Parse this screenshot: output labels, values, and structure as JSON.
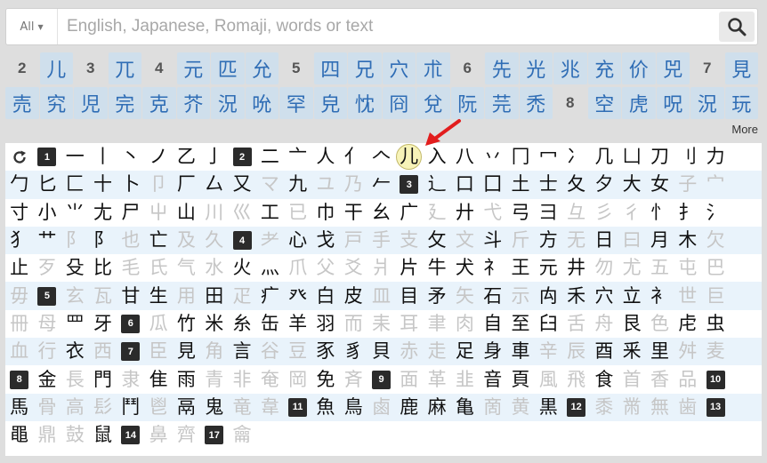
{
  "search": {
    "scope": "All",
    "placeholder": "English, Japanese, Romaji, words or text",
    "icon": "search-icon"
  },
  "results": {
    "rows": [
      [
        "2",
        "儿",
        "3",
        "兀",
        "4",
        "元",
        "匹",
        "允",
        "5",
        "四",
        "兄",
        "穴",
        "朮",
        "6",
        "先",
        "光",
        "兆",
        "充",
        "价",
        "兕",
        "7",
        "見"
      ],
      [
        "売",
        "究",
        "児",
        "完",
        "克",
        "芥",
        "況",
        "吮",
        "罕",
        "皃",
        "忱",
        "冏",
        "兌",
        "阮",
        "芫",
        "禿",
        "8",
        "空",
        "虎",
        "呪",
        "況",
        "玩"
      ]
    ],
    "more_label": "More"
  },
  "panel": {
    "selected": "儿",
    "rows": [
      [
        "@r",
        "#1",
        "一",
        "丨",
        "丶",
        "ノ",
        "乙",
        "亅",
        "#2",
        "二",
        "亠",
        "人",
        "亻",
        "𠆢",
        "*儿",
        "入",
        "八",
        "丷",
        "冂",
        "冖",
        "冫",
        "几",
        "凵",
        "刀",
        "刂",
        "力"
      ],
      [
        "勹",
        "匕",
        "匚",
        "十",
        "卜",
        "~卩",
        "厂",
        "厶",
        "又",
        "~マ",
        "九",
        "~ユ",
        "~乃",
        "𠂉",
        "#3",
        "⻌",
        "口",
        "囗",
        "土",
        "士",
        "夂",
        "夕",
        "大",
        "女",
        "~子",
        "~宀"
      ],
      [
        "寸",
        "小",
        "⺌",
        "尢",
        "尸",
        "~屮",
        "山",
        "~川",
        "~巛",
        "工",
        "~已",
        "巾",
        "干",
        "幺",
        "广",
        "~廴",
        "廾",
        "~弋",
        "弓",
        "彐",
        "~彑",
        "~彡",
        "~彳",
        "忄",
        "扌",
        "氵"
      ],
      [
        "犭",
        "艹",
        "~阝",
        "阝",
        "~也",
        "亡",
        "~及",
        "~久",
        "#4",
        "~耂",
        "心",
        "戈",
        "~戸",
        "~手",
        "~支",
        "攵",
        "~文",
        "斗",
        "~斤",
        "方",
        "~无",
        "日",
        "~曰",
        "月",
        "木",
        "~欠"
      ],
      [
        "止",
        "~歹",
        "殳",
        "比",
        "~毛",
        "~氏",
        "~气",
        "~水",
        "火",
        "灬",
        "~爪",
        "~父",
        "~爻",
        "~爿",
        "片",
        "牛",
        "犬",
        "礻",
        "王",
        "元",
        "井",
        "~勿",
        "~尤",
        "~五",
        "~屯",
        "~巴"
      ],
      [
        "~毋",
        "#5",
        "~玄",
        "~瓦",
        "甘",
        "生",
        "~用",
        "田",
        "~疋",
        "疒",
        "癶",
        "白",
        "皮",
        "~皿",
        "目",
        "矛",
        "~矢",
        "石",
        "~示",
        "禸",
        "禾",
        "穴",
        "立",
        "衤",
        "~世",
        "~巨"
      ],
      [
        "~冊",
        "~母",
        "罒",
        "牙",
        "#6",
        "~瓜",
        "竹",
        "米",
        "糸",
        "缶",
        "羊",
        "羽",
        "~而",
        "~耒",
        "~耳",
        "~聿",
        "~肉",
        "自",
        "至",
        "臼",
        "~舌",
        "~舟",
        "艮",
        "~色",
        "虍",
        "虫"
      ],
      [
        "~血",
        "~行",
        "衣",
        "~西",
        "#7",
        "~臣",
        "見",
        "~角",
        "言",
        "~谷",
        "~豆",
        "豕",
        "豸",
        "貝",
        "~赤",
        "~走",
        "足",
        "身",
        "車",
        "~辛",
        "~辰",
        "酉",
        "釆",
        "里",
        "~舛",
        "~麦"
      ],
      [
        "#8",
        "金",
        "~長",
        "門",
        "~隶",
        "隹",
        "雨",
        "~青",
        "~非",
        "~奄",
        "~岡",
        "免",
        "~斉",
        "#9",
        "~面",
        "~革",
        "~韭",
        "音",
        "頁",
        "~風",
        "~飛",
        "食",
        "~首",
        "~香",
        "~品",
        "#10"
      ],
      [
        "馬",
        "~骨",
        "~高",
        "~髟",
        "鬥",
        "~鬯",
        "鬲",
        "鬼",
        "~竜",
        "~韋",
        "#11",
        "魚",
        "鳥",
        "~鹵",
        "鹿",
        "麻",
        "亀",
        "~啇",
        "~黄",
        "黒",
        "#12",
        "~黍",
        "~黹",
        "~無",
        "~歯",
        "#13"
      ],
      [
        "黽",
        "~鼎",
        "~鼓",
        "鼠",
        "#14",
        "~鼻",
        "~齊",
        "#17",
        "~龠"
      ]
    ]
  }
}
